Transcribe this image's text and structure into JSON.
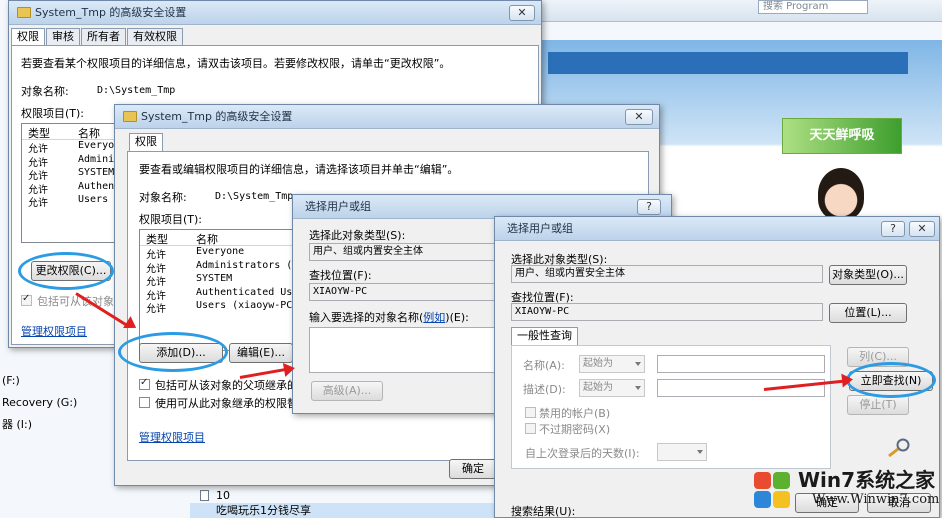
{
  "background": {
    "search_placeholder": "搜索 Program",
    "ad_text": "天天鲜呼吸",
    "left_labels": [
      "(F:)",
      "Recovery (G:)",
      "器 (I:)"
    ],
    "bottom_rows": [
      "10",
      "吃喝玩乐1分钱尽享"
    ]
  },
  "dlg1": {
    "title": "System_Tmp 的高级安全设置",
    "tabs": [
      "权限",
      "审核",
      "所有者",
      "有效权限"
    ],
    "intro": "若要查看某个权限项目的详细信息，请双击该项目。若要修改权限，请单击“更改权限”。",
    "object_label": "对象名称:",
    "object_value": "D:\\System_Tmp",
    "entries_label": "权限项目(T):",
    "columns": [
      "类型",
      "名称"
    ],
    "rows": [
      {
        "type": "允许",
        "name": "Everyon"
      },
      {
        "type": "允许",
        "name": "Adminis"
      },
      {
        "type": "允许",
        "name": "SYSTEM"
      },
      {
        "type": "允许",
        "name": "Authent"
      },
      {
        "type": "允许",
        "name": "Users ("
      }
    ],
    "change_button": "更改权限(C)...",
    "inherit_label": "包括可从该对象",
    "manage_link": "管理权限项目",
    "close_glyph": "✕"
  },
  "dlg2": {
    "title": "System_Tmp 的高级安全设置",
    "tab": "权限",
    "intro": "要查看或编辑权限项目的详细信息，请选择该项目并单击“编辑”。",
    "object_label": "对象名称:",
    "object_value": "D:\\System_Tmp",
    "entries_label": "权限项目(T):",
    "columns": [
      "类型",
      "名称"
    ],
    "rows": [
      {
        "type": "允许",
        "name": "Everyone"
      },
      {
        "type": "允许",
        "name": "Administrators (xi"
      },
      {
        "type": "允许",
        "name": "SYSTEM"
      },
      {
        "type": "允许",
        "name": "Authenticated Users"
      },
      {
        "type": "允许",
        "name": "Users (xiaoyw-PC\\U"
      }
    ],
    "add_button": "添加(D)...",
    "edit_button": "编辑(E)...",
    "inherit_label": "包括可从该对象的父项继承的权",
    "replace_label": "使用可从此对象继承的权限替换",
    "manage_link": "管理权限项目",
    "ok_button": "确定",
    "close_glyph": "✕"
  },
  "dlg3": {
    "title": "选择用户或组",
    "type_label": "选择此对象类型(S):",
    "type_value": "用户、组或内置安全主体",
    "location_label": "查找位置(F):",
    "location_value": "XIAOYW-PC",
    "names_label_pre": "输入要选择的对象名称(",
    "names_label_link": "例如",
    "names_label_post": ")(E):",
    "advanced_button": "高级(A)...",
    "help_glyph": "?",
    "close_glyph": "✕"
  },
  "dlg4": {
    "title": "选择用户或组",
    "type_label": "选择此对象类型(S):",
    "type_value": "用户、组或内置安全主体",
    "type_button": "对象类型(O)...",
    "location_label": "查找位置(F):",
    "location_value": "XIAOYW-PC",
    "location_button": "位置(L)...",
    "tab": "一般性查询",
    "name_label": "名称(A):",
    "desc_label": "描述(D):",
    "starts_with": "起始为",
    "columns_button": "列(C)...",
    "find_now_button": "立即查找(N)",
    "stop_button": "停止(T)",
    "disabled_accounts": "禁用的帐户(B)",
    "no_expire": "不过期密码(X)",
    "days_label": "自上次登录后的天数(I):",
    "results_label": "搜索结果(U):",
    "ok_button": "确定",
    "cancel_button": "取消",
    "help_glyph": "?",
    "close_glyph": "✕"
  },
  "watermark": {
    "brand": "Win7系统之家",
    "url": "Www.Winwin7.com"
  },
  "colors": {
    "highlight_ellipse": "#2b9be3",
    "arrow": "#e02020",
    "link": "#0645ad"
  }
}
